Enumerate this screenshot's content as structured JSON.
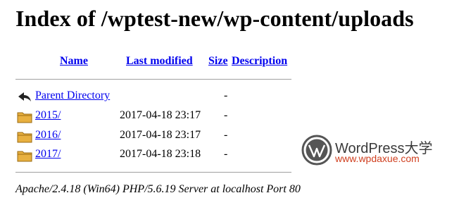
{
  "page": {
    "title": "Index of /wptest-new/wp-content/uploads",
    "server_signature": "Apache/2.4.18 (Win64) PHP/5.6.19 Server at localhost Port 80"
  },
  "columns": {
    "name": "Name",
    "last_modified": "Last modified",
    "size": "Size",
    "description": "Description"
  },
  "entries": [
    {
      "icon": "back-arrow-icon",
      "name": "Parent Directory",
      "modified": "",
      "size": "-"
    },
    {
      "icon": "folder-icon",
      "name": "2015/",
      "modified": "2017-04-18 23:17",
      "size": "-"
    },
    {
      "icon": "folder-icon",
      "name": "2016/",
      "modified": "2017-04-18 23:17",
      "size": "-"
    },
    {
      "icon": "folder-icon",
      "name": "2017/",
      "modified": "2017-04-18 23:18",
      "size": "-"
    }
  ],
  "watermark": {
    "brand": "WordPress大学",
    "url": "www.wpdaxue.com"
  },
  "colors": {
    "link": "#0000ee",
    "folder": "#e8b040",
    "watermark_url": "#d04020"
  }
}
